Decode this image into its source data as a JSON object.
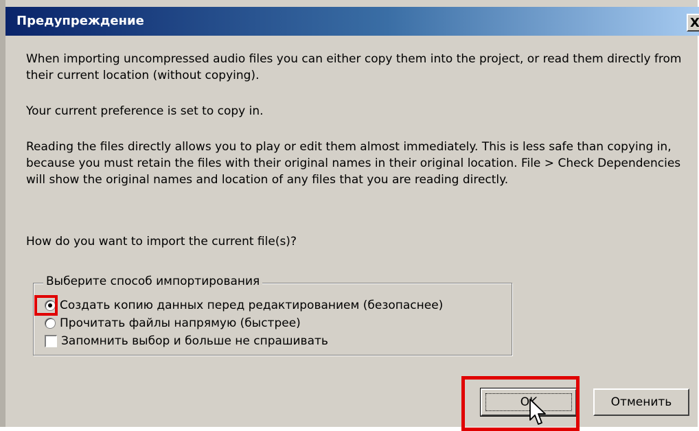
{
  "dialog": {
    "title": "Предупреждение",
    "close_label": "X",
    "messages": [
      "When importing uncompressed audio files you can either copy them into the project, or read them directly from their current location (without copying).",
      "Your current preference is set to copy in.",
      "Reading the files directly allows you to play or edit them almost immediately.  This is less safe than copying in, because you must retain the files with their original names in their original location. File > Check Dependencies will show the original names and location of any files that you are reading directly.",
      "How do you want to import the current file(s)?"
    ],
    "group": {
      "legend": "Выберите способ импортирования",
      "options": [
        {
          "label": "Создать копию данных перед редактированием (безопаснее)",
          "selected": true
        },
        {
          "label": "Прочитать файлы напрямую (быстрее)",
          "selected": false
        }
      ],
      "remember": {
        "label": "Запомнить выбор и больше не спрашивать",
        "checked": false
      }
    },
    "buttons": {
      "ok": "OK",
      "cancel": "Отменить"
    }
  },
  "colors": {
    "titlebar_start": "#0a246a",
    "titlebar_end": "#a6caf0",
    "dialog_bg": "#d4d0c8",
    "highlight": "#e00000"
  },
  "icons": {
    "close": "close-icon",
    "cursor": "mouse-pointer-icon"
  }
}
